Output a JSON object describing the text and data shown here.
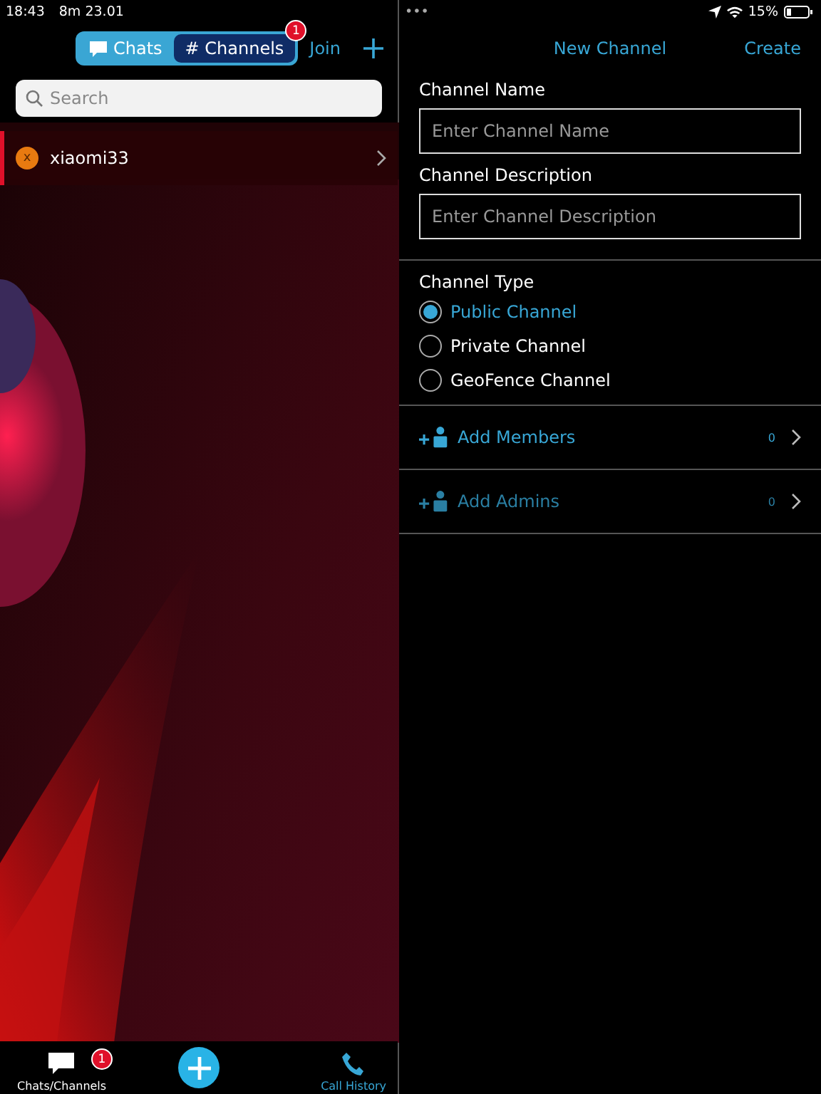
{
  "status_bar": {
    "time": "18:43",
    "carrier": "8m 23.01",
    "dots": "•••",
    "battery": "15%"
  },
  "left": {
    "tabs": [
      {
        "label": "Chats",
        "selected": false
      },
      {
        "label": "# Channels",
        "selected": true,
        "badge": "1"
      }
    ],
    "join": "Join",
    "search": {
      "placeholder": "Search"
    },
    "rows": [
      {
        "initial": "x",
        "name": "xiaomi33"
      }
    ],
    "bottom_tabs": [
      {
        "label": "Chats/Channels",
        "badge": "1",
        "selected": true
      },
      {
        "label": "Call History",
        "selected": false
      }
    ]
  },
  "right": {
    "title": "New Channel",
    "create": "Create",
    "fields": [
      {
        "label": "Channel Name",
        "placeholder": "Enter Channel Name"
      },
      {
        "label": "Channel Description",
        "placeholder": "Enter Channel Description"
      }
    ],
    "type_label": "Channel Type",
    "options": [
      {
        "label": "Public Channel",
        "selected": true
      },
      {
        "label": "Private Channel",
        "selected": false
      },
      {
        "label": "GeoFence Channel",
        "selected": false
      }
    ],
    "links": [
      {
        "label": "Add Members",
        "count": "0",
        "disabled": false
      },
      {
        "label": "Add Admins",
        "count": "0",
        "disabled": true
      }
    ]
  }
}
